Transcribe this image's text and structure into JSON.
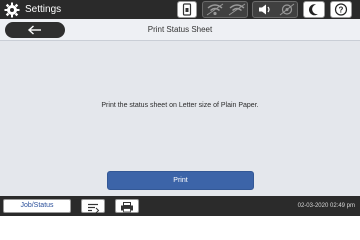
{
  "header": {
    "title": "Settings",
    "gear_icon": "gear-icon"
  },
  "status_icons": [
    "sim-card-icon",
    "wifi-icon",
    "wifi-direct-icon",
    "volume-icon",
    "quiet-mode-icon",
    "sleep-moon-icon",
    "help-icon"
  ],
  "navigation": {
    "back_icon": "arrow-left-icon",
    "page_title": "Print Status Sheet"
  },
  "main": {
    "message": "Print the status sheet on Letter size of Plain Paper.",
    "print_label": "Print"
  },
  "footer": {
    "job_status_label": "Job/Status",
    "datetime": "02-03-2020 02:49 pm"
  },
  "colors": {
    "accent": "#3c64a8",
    "topbar": "#2a2a2a",
    "content_bg": "#e4e7ec"
  }
}
